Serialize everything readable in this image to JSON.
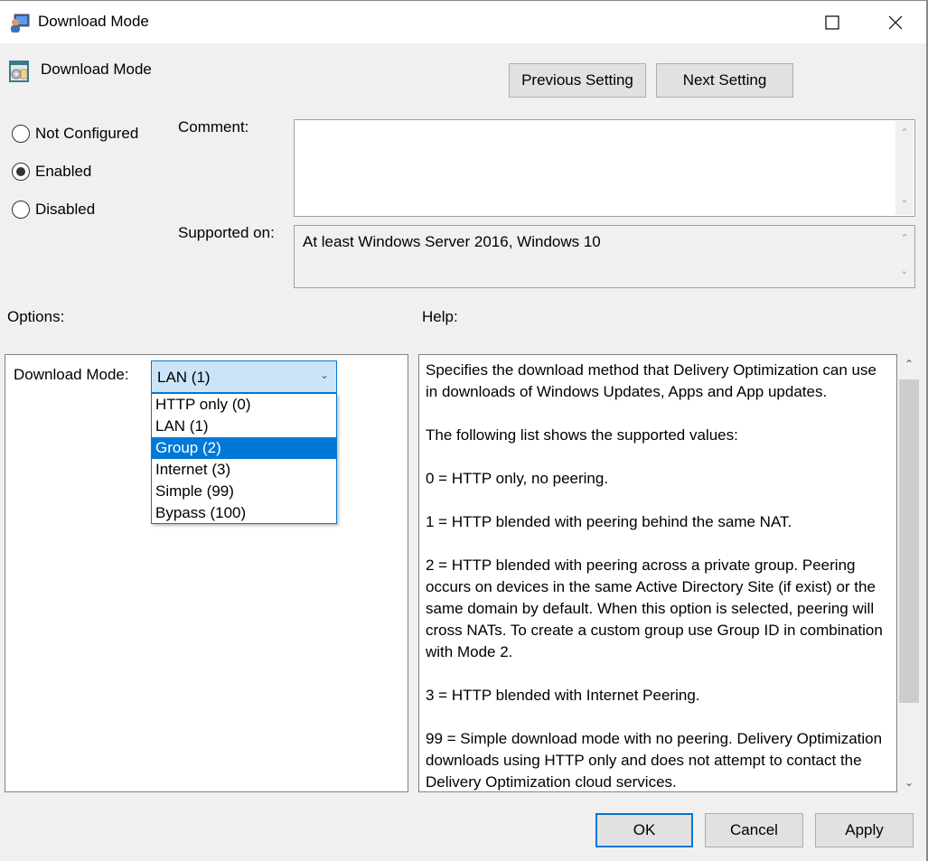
{
  "window": {
    "title": "Download Mode",
    "maximize_glyph": "☐",
    "close_glyph": "✕"
  },
  "header": {
    "setting_name": "Download Mode",
    "previous_label": "Previous Setting",
    "next_label": "Next Setting"
  },
  "state": {
    "options": [
      {
        "label": "Not Configured",
        "checked": false
      },
      {
        "label": "Enabled",
        "checked": true
      },
      {
        "label": "Disabled",
        "checked": false
      }
    ]
  },
  "comment": {
    "label": "Comment:",
    "value": ""
  },
  "supported": {
    "label": "Supported on:",
    "value": "At least Windows Server 2016, Windows 10"
  },
  "options_section": {
    "label": "Options:",
    "download_mode_label": "Download Mode:",
    "selected_value": "LAN (1)",
    "dropdown_items": [
      {
        "label": "HTTP only (0)",
        "highlighted": false
      },
      {
        "label": "LAN (1)",
        "highlighted": false
      },
      {
        "label": "Group (2)",
        "highlighted": true
      },
      {
        "label": "Internet (3)",
        "highlighted": false
      },
      {
        "label": "Simple (99)",
        "highlighted": false
      },
      {
        "label": "Bypass (100)",
        "highlighted": false
      }
    ]
  },
  "help_section": {
    "label": "Help:",
    "text": "Specifies the download method that Delivery Optimization can use in downloads of Windows Updates, Apps and App updates.\n\nThe following list shows the supported values:\n\n0 = HTTP only, no peering.\n\n1 = HTTP blended with peering behind the same NAT.\n\n2 = HTTP blended with peering across a private group. Peering occurs on devices in the same Active Directory Site (if exist) or the same domain by default. When this option is selected, peering will cross NATs. To create a custom group use Group ID in combination with Mode 2.\n\n3 = HTTP blended with Internet Peering.\n\n99 = Simple download mode with no peering. Delivery Optimization downloads using HTTP only and does not attempt to contact the Delivery Optimization cloud services."
  },
  "footer": {
    "ok_label": "OK",
    "cancel_label": "Cancel",
    "apply_label": "Apply"
  },
  "colors": {
    "accent": "#0078d7",
    "combo_bg": "#cce4f7",
    "dialog_bg": "#f0f0f0"
  }
}
